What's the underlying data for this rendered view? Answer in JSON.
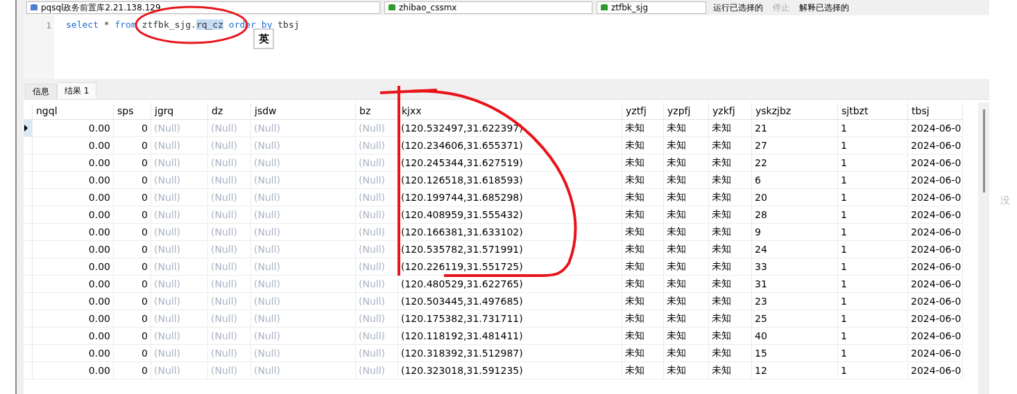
{
  "toolbar": {
    "connection": "pqsql政务前置库2.21.138.129",
    "database": "zhibao_cssmx",
    "schema": "ztfbk_sjg",
    "buttons": [
      {
        "label": "运行已选择的",
        "disabled": false
      },
      {
        "label": "停止",
        "disabled": true
      },
      {
        "label": "解释已选择的",
        "disabled": false
      }
    ]
  },
  "editor": {
    "lines": [
      {
        "number": "1",
        "tokens": [
          {
            "text": "select",
            "kind": "keyword"
          },
          {
            "text": "*",
            "kind": "plain"
          },
          {
            "text": "from",
            "kind": "keyword"
          },
          {
            "text": "ztfbk_sjg.",
            "kind": "plain",
            "attach": true
          },
          {
            "text": "rq_cz",
            "kind": "highlight"
          },
          {
            "text": "order by",
            "kind": "keyword"
          },
          {
            "text": "tbsj",
            "kind": "plain"
          }
        ]
      }
    ],
    "ime_indicator": "英"
  },
  "tabs": [
    {
      "label": "信息",
      "selected": false
    },
    {
      "label": "结果 1",
      "selected": true
    }
  ],
  "table": {
    "columns": [
      {
        "label": "ngql",
        "numeric": true,
        "muted": false
      },
      {
        "label": "sps",
        "numeric": true,
        "muted": false
      },
      {
        "label": "jgrq",
        "numeric": false,
        "muted": true
      },
      {
        "label": "dz",
        "numeric": false,
        "muted": true
      },
      {
        "label": "jsdw",
        "numeric": false,
        "muted": true
      },
      {
        "label": "bz",
        "numeric": false,
        "muted": true
      },
      {
        "label": "kjxx",
        "numeric": false,
        "muted": false
      },
      {
        "label": "yztfj",
        "numeric": false,
        "muted": false
      },
      {
        "label": "yzpfj",
        "numeric": false,
        "muted": false
      },
      {
        "label": "yzkfj",
        "numeric": false,
        "muted": false
      },
      {
        "label": "yskzjbz",
        "numeric": false,
        "muted": false
      },
      {
        "label": "sjtbzt",
        "numeric": false,
        "muted": false
      },
      {
        "label": "tbsj",
        "numeric": false,
        "muted": false
      }
    ],
    "rows": [
      {
        "selected": true,
        "cells": [
          "0.00",
          "0",
          "(Null)",
          "(Null)",
          "(Null)",
          "(Null)",
          "(120.532497,31.622397)",
          "未知",
          "未知",
          "未知",
          "21",
          "1",
          "2024-06-0"
        ]
      },
      {
        "selected": false,
        "cells": [
          "0.00",
          "0",
          "(Null)",
          "(Null)",
          "(Null)",
          "(Null)",
          "(120.234606,31.655371)",
          "未知",
          "未知",
          "未知",
          "27",
          "1",
          "2024-06-0"
        ]
      },
      {
        "selected": false,
        "cells": [
          "0.00",
          "0",
          "(Null)",
          "(Null)",
          "(Null)",
          "(Null)",
          "(120.245344,31.627519)",
          "未知",
          "未知",
          "未知",
          "22",
          "1",
          "2024-06-0"
        ]
      },
      {
        "selected": false,
        "cells": [
          "0.00",
          "0",
          "(Null)",
          "(Null)",
          "(Null)",
          "(Null)",
          "(120.126518,31.618593)",
          "未知",
          "未知",
          "未知",
          "6",
          "1",
          "2024-06-0"
        ]
      },
      {
        "selected": false,
        "cells": [
          "0.00",
          "0",
          "(Null)",
          "(Null)",
          "(Null)",
          "(Null)",
          "(120.199744,31.685298)",
          "未知",
          "未知",
          "未知",
          "20",
          "1",
          "2024-06-0"
        ]
      },
      {
        "selected": false,
        "cells": [
          "0.00",
          "0",
          "(Null)",
          "(Null)",
          "(Null)",
          "(Null)",
          "(120.408959,31.555432)",
          "未知",
          "未知",
          "未知",
          "28",
          "1",
          "2024-06-0"
        ]
      },
      {
        "selected": false,
        "cells": [
          "0.00",
          "0",
          "(Null)",
          "(Null)",
          "(Null)",
          "(Null)",
          "(120.166381,31.633102)",
          "未知",
          "未知",
          "未知",
          "9",
          "1",
          "2024-06-0"
        ]
      },
      {
        "selected": false,
        "cells": [
          "0.00",
          "0",
          "(Null)",
          "(Null)",
          "(Null)",
          "(Null)",
          "(120.535782,31.571991)",
          "未知",
          "未知",
          "未知",
          "24",
          "1",
          "2024-06-0"
        ]
      },
      {
        "selected": false,
        "cells": [
          "0.00",
          "0",
          "(Null)",
          "(Null)",
          "(Null)",
          "(Null)",
          "(120.226119,31.551725)",
          "未知",
          "未知",
          "未知",
          "33",
          "1",
          "2024-06-0"
        ]
      },
      {
        "selected": false,
        "cells": [
          "0.00",
          "0",
          "(Null)",
          "(Null)",
          "(Null)",
          "(Null)",
          "(120.480529,31.622765)",
          "未知",
          "未知",
          "未知",
          "31",
          "1",
          "2024-06-0"
        ]
      },
      {
        "selected": false,
        "cells": [
          "0.00",
          "0",
          "(Null)",
          "(Null)",
          "(Null)",
          "(Null)",
          "(120.503445,31.497685)",
          "未知",
          "未知",
          "未知",
          "23",
          "1",
          "2024-06-0"
        ]
      },
      {
        "selected": false,
        "cells": [
          "0.00",
          "0",
          "(Null)",
          "(Null)",
          "(Null)",
          "(Null)",
          "(120.175382,31.731711)",
          "未知",
          "未知",
          "未知",
          "25",
          "1",
          "2024-06-0"
        ]
      },
      {
        "selected": false,
        "cells": [
          "0.00",
          "0",
          "(Null)",
          "(Null)",
          "(Null)",
          "(Null)",
          "(120.118192,31.481411)",
          "未知",
          "未知",
          "未知",
          "40",
          "1",
          "2024-06-0"
        ]
      },
      {
        "selected": false,
        "cells": [
          "0.00",
          "0",
          "(Null)",
          "(Null)",
          "(Null)",
          "(Null)",
          "(120.318392,31.512987)",
          "未知",
          "未知",
          "未知",
          "15",
          "1",
          "2024-06-0"
        ]
      },
      {
        "selected": false,
        "cells": [
          "0.00",
          "0",
          "(Null)",
          "(Null)",
          "(Null)",
          "(Null)",
          "(120.323018,31.591235)",
          "未知",
          "未知",
          "未知",
          "12",
          "1",
          "2024-06-0"
        ]
      }
    ]
  },
  "side_note": "没"
}
